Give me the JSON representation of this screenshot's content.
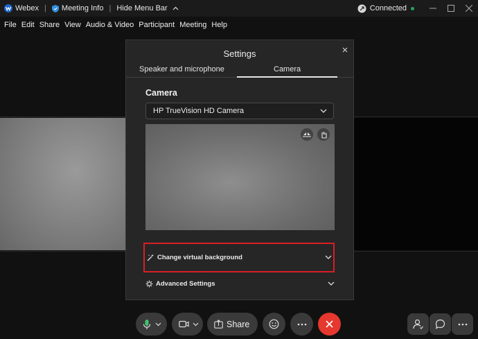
{
  "titlebar": {
    "app_name": "Webex",
    "meeting_info": "Meeting Info",
    "hide_menu_bar": "Hide Menu Bar",
    "connection_status": "Connected",
    "app_icon": "webex-logo-icon",
    "meeting_info_icon": "shield-icon",
    "hide_menu_icon": "chevron-up-icon",
    "connection_icon": "connection-icon",
    "status_color": "#29a35a"
  },
  "menubar": {
    "items": [
      {
        "label": "File"
      },
      {
        "label": "Edit"
      },
      {
        "label": "Share"
      },
      {
        "label": "View"
      },
      {
        "label": "Audio & Video"
      },
      {
        "label": "Participant"
      },
      {
        "label": "Meeting"
      },
      {
        "label": "Help"
      }
    ]
  },
  "settings": {
    "title": "Settings",
    "tabs": [
      {
        "label": "Speaker and microphone",
        "active": false
      },
      {
        "label": "Camera",
        "active": true
      }
    ],
    "camera_section_title": "Camera",
    "camera_select_value": "HP TrueVision HD Camera",
    "virtual_background_label": "Change virtual background",
    "advanced_settings_label": "Advanced Settings",
    "highlight_color": "#d81f26"
  },
  "controls": {
    "share_label": "Share",
    "end_color": "#e5382e",
    "icons": [
      "microphone-icon",
      "camera-icon",
      "share-icon",
      "reactions-icon",
      "more-icon",
      "end-call-icon",
      "participants-icon",
      "chat-icon",
      "more-options-icon"
    ]
  }
}
